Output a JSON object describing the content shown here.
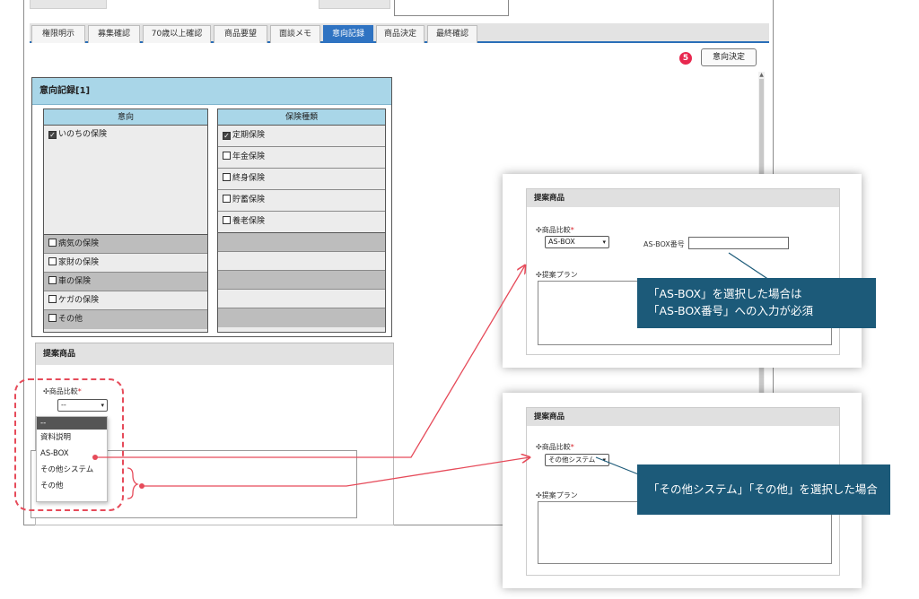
{
  "tabs": [
    "権限明示",
    "募集確認",
    "70歳以上確認",
    "商品要望",
    "面談メモ",
    "意向記録",
    "商品決定",
    "最終確認"
  ],
  "active_tab": "意向記録",
  "badge_number": "5",
  "decision_button": "意向決定",
  "intent_panel": {
    "title": "意向記録[1]",
    "col_intent": "意向",
    "col_insurance": "保険種類",
    "intent_top": {
      "label": "いのちの保険",
      "checked": true
    },
    "intent_items": [
      "病気の保険",
      "家財の保険",
      "車の保険",
      "ケガの保険",
      "その他"
    ],
    "insurance_items": [
      {
        "label": "定期保険",
        "checked": true
      },
      {
        "label": "年金保険",
        "checked": false
      },
      {
        "label": "終身保険",
        "checked": false
      },
      {
        "label": "貯蓄保険",
        "checked": false
      },
      {
        "label": "養老保険",
        "checked": false
      }
    ]
  },
  "proposal": {
    "title": "提案商品",
    "compare_label": "✣商品比較",
    "required_mark": "*",
    "plan_label": "✣提案プラン",
    "select_value": "--",
    "dropdown_options": [
      "--",
      "資料説明",
      "AS-BOX",
      "その他システム",
      "その他"
    ],
    "plan_prefix": "✣"
  },
  "card1": {
    "title": "提案商品",
    "compare_label": "✣商品比較",
    "required_mark": "*",
    "select_value": "AS-BOX",
    "field_label": "AS-BOX番号",
    "plan_label": "✣提案プラン"
  },
  "card2": {
    "title": "提案商品",
    "compare_label": "✣商品比較",
    "required_mark": "*",
    "select_value": "その他システム",
    "plan_label": "✣提案プラン"
  },
  "callout1": {
    "line1": "「AS-BOX」を選択した場合は",
    "line2": "「AS-BOX番号」への入力が必須"
  },
  "callout2": {
    "line1": "「その他システム」「その他」を選択した場合"
  },
  "colors": {
    "accent": "#2f73c2",
    "header_blue": "#a9d6e8",
    "callout": "#1c5a79",
    "arrow_red": "#e64b5a",
    "badge": "#e8284f"
  }
}
